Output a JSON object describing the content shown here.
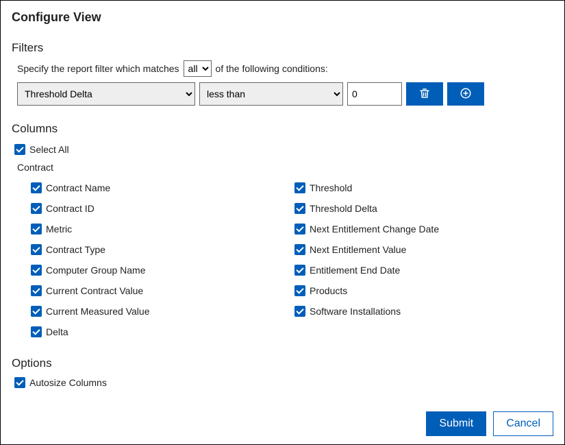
{
  "title": "Configure View",
  "filters": {
    "heading": "Filters",
    "sentence_prefix": "Specify the report filter which matches",
    "match_mode": "all",
    "sentence_suffix": "of the following conditions:",
    "row": {
      "field": "Threshold Delta",
      "operator": "less than",
      "value": "0"
    }
  },
  "columns": {
    "heading": "Columns",
    "select_all_label": "Select All",
    "group_label": "Contract",
    "left": [
      "Contract Name",
      "Contract ID",
      "Metric",
      "Contract Type",
      "Computer Group Name",
      "Current Contract Value",
      "Current Measured Value",
      "Delta"
    ],
    "right": [
      "Threshold",
      "Threshold Delta",
      "Next Entitlement Change Date",
      "Next Entitlement Value",
      "Entitlement End Date",
      "Products",
      "Software Installations"
    ]
  },
  "options": {
    "heading": "Options",
    "autosize_label": "Autosize Columns"
  },
  "footer": {
    "submit_label": "Submit",
    "cancel_label": "Cancel"
  }
}
